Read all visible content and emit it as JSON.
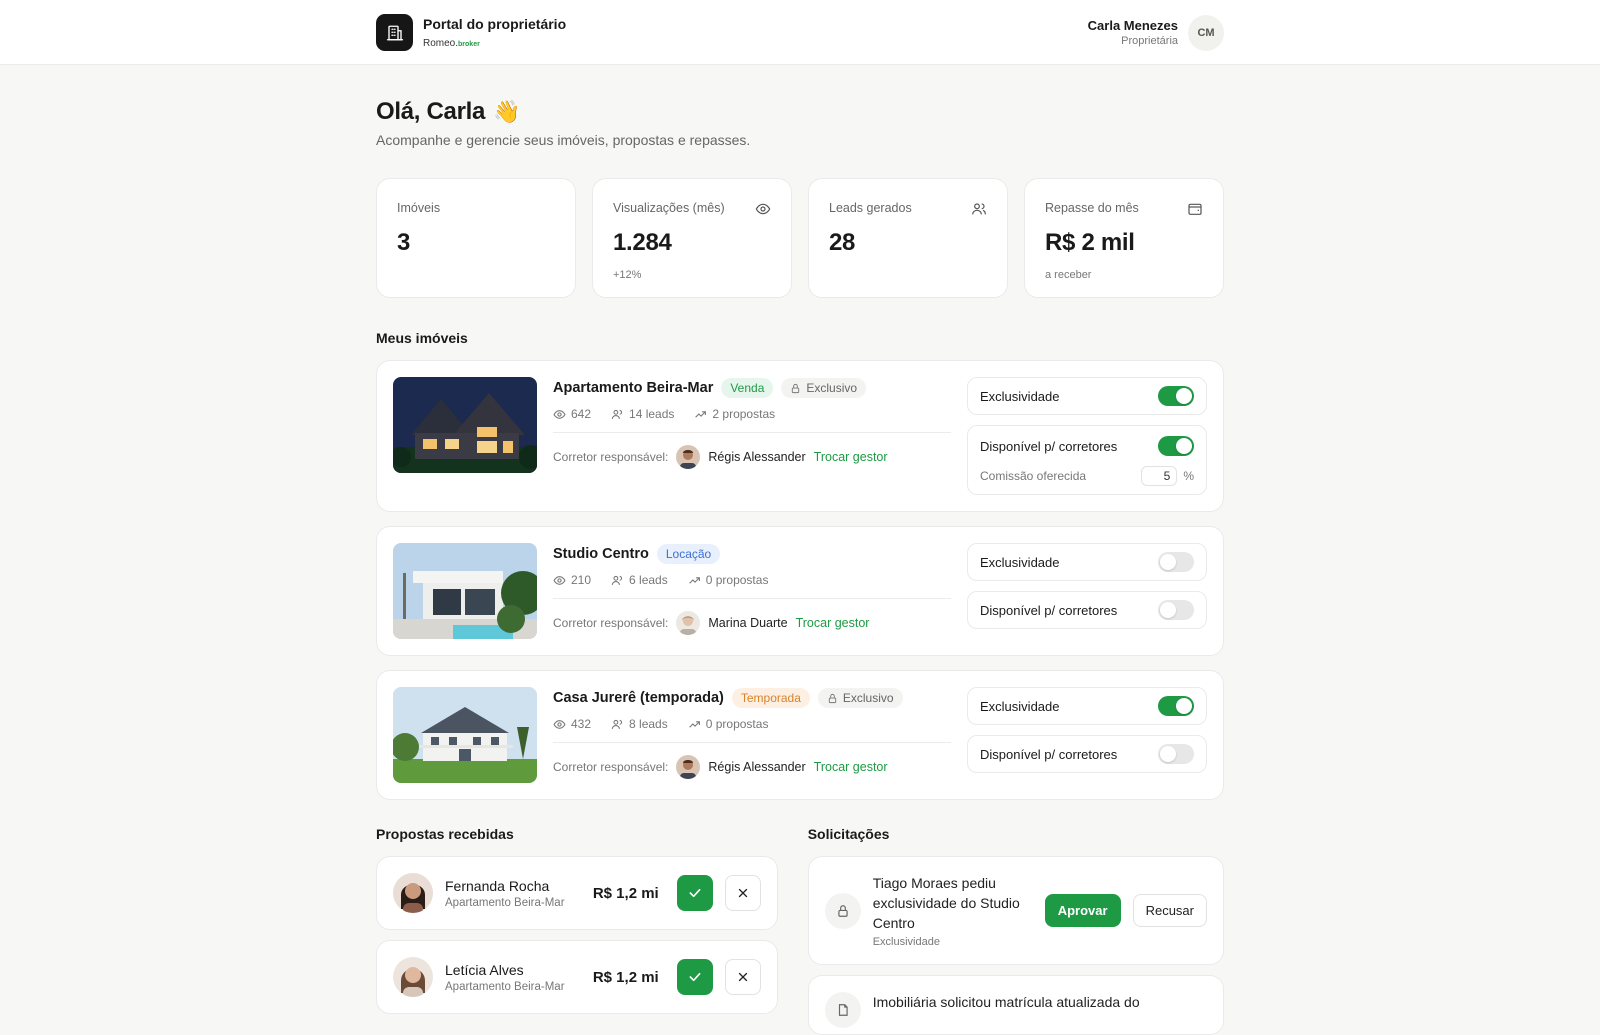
{
  "header": {
    "title": "Portal do proprietário",
    "brand_name": "Romeo",
    "brand_suffix": "broker",
    "user_name": "Carla Menezes",
    "user_role": "Proprietária",
    "user_initials": "CM"
  },
  "greeting": {
    "title": "Olá, Carla",
    "emoji": "👋",
    "subtitle": "Acompanhe e gerencie seus imóveis, propostas e repasses."
  },
  "stats": [
    {
      "label": "Imóveis",
      "value": "3",
      "note": ""
    },
    {
      "label": "Visualizações (mês)",
      "value": "1.284",
      "note": "+12%"
    },
    {
      "label": "Leads gerados",
      "value": "28",
      "note": ""
    },
    {
      "label": "Repasse do mês",
      "value": "R$ 2 mil",
      "note": "a receber"
    }
  ],
  "properties_title": "Meus imóveis",
  "properties": [
    {
      "name": "Apartamento Beira-Mar",
      "type": "Venda",
      "exclusive_badge": "Exclusivo",
      "views": "642",
      "leads": "14 leads",
      "proposals": "2 propostas",
      "broker_label": "Corretor responsável:",
      "broker_name": "Régis Alessander",
      "swap_label": "Trocar gestor",
      "exclusivity_label": "Exclusividade",
      "exclusivity_on": true,
      "available_label": "Disponível p/ corretores",
      "available_on": true,
      "commission_label": "Comissão oferecida",
      "commission_value": "5",
      "commission_unit": "%"
    },
    {
      "name": "Studio Centro",
      "type": "Locação",
      "exclusive_badge": "",
      "views": "210",
      "leads": "6 leads",
      "proposals": "0 propostas",
      "broker_label": "Corretor responsável:",
      "broker_name": "Marina Duarte",
      "swap_label": "Trocar gestor",
      "exclusivity_label": "Exclusividade",
      "exclusivity_on": false,
      "available_label": "Disponível p/ corretores",
      "available_on": false
    },
    {
      "name": "Casa Jurerê (temporada)",
      "type": "Temporada",
      "exclusive_badge": "Exclusivo",
      "views": "432",
      "leads": "8 leads",
      "proposals": "0 propostas",
      "broker_label": "Corretor responsável:",
      "broker_name": "Régis Alessander",
      "swap_label": "Trocar gestor",
      "exclusivity_label": "Exclusividade",
      "exclusivity_on": true,
      "available_label": "Disponível p/ corretores",
      "available_on": false
    }
  ],
  "offers_title": "Propostas recebidas",
  "offers": [
    {
      "name": "Fernanda Rocha",
      "property": "Apartamento Beira-Mar",
      "value": "R$ 1,2 mi"
    },
    {
      "name": "Letícia Alves",
      "property": "Apartamento Beira-Mar",
      "value": "R$ 1,2 mi"
    }
  ],
  "requests_title": "Solicitações",
  "requests": [
    {
      "title": "Tiago Moraes pediu exclusividade do Studio Centro",
      "tag": "Exclusividade",
      "approve": "Aprovar",
      "refuse": "Recusar"
    },
    {
      "title": "Imobiliária solicitou matrícula atualizada do",
      "tag": ""
    }
  ],
  "colors": {
    "accent": "#1e9a45",
    "rent": "#3d6fd1",
    "season": "#d9822b"
  },
  "icons": [
    "building-icon",
    "eye-icon",
    "users-icon",
    "wallet-icon",
    "lock-icon",
    "trend-icon",
    "check-icon",
    "close-icon"
  ]
}
